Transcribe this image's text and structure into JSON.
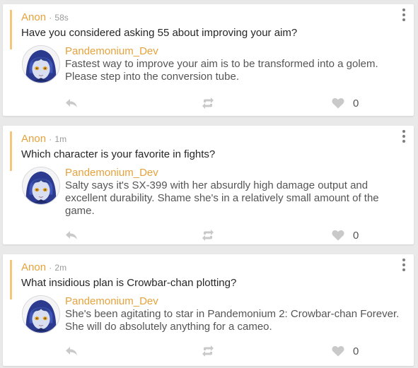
{
  "colors": {
    "accent": "#e5a23c",
    "quote_bar": "#f2c77c",
    "icon": "#c9c9c9",
    "background": "#e9e9e9"
  },
  "items": [
    {
      "asker": "Anon",
      "separator": "·",
      "time": "58s",
      "question": "Have you considered asking 55 about improving your aim?",
      "answerer": "Pandemonium_Dev",
      "answer": "Fastest way to improve your aim is to be transformed into a golem. Please step into the conversion tube.",
      "likes": "0"
    },
    {
      "asker": "Anon",
      "separator": "·",
      "time": "1m",
      "question": "Which character is your favorite in fights?",
      "answerer": "Pandemonium_Dev",
      "answer": "Salty says it's SX-399 with her absurdly high damage output and excellent durability. Shame she's in a relatively small amount of the game.",
      "likes": "0"
    },
    {
      "asker": "Anon",
      "separator": "·",
      "time": "2m",
      "question": "What insidious plan is Crowbar-chan plotting?",
      "answerer": "Pandemonium_Dev",
      "answer": "She's been agitating to star in Pandemonium 2: Crowbar-chan Forever. She will do absolutely anything for a cameo.",
      "likes": "0"
    }
  ],
  "icons": {
    "menu": "more-vertical-icon",
    "reply": "reply-icon",
    "repost": "repost-icon",
    "like": "heart-icon"
  }
}
